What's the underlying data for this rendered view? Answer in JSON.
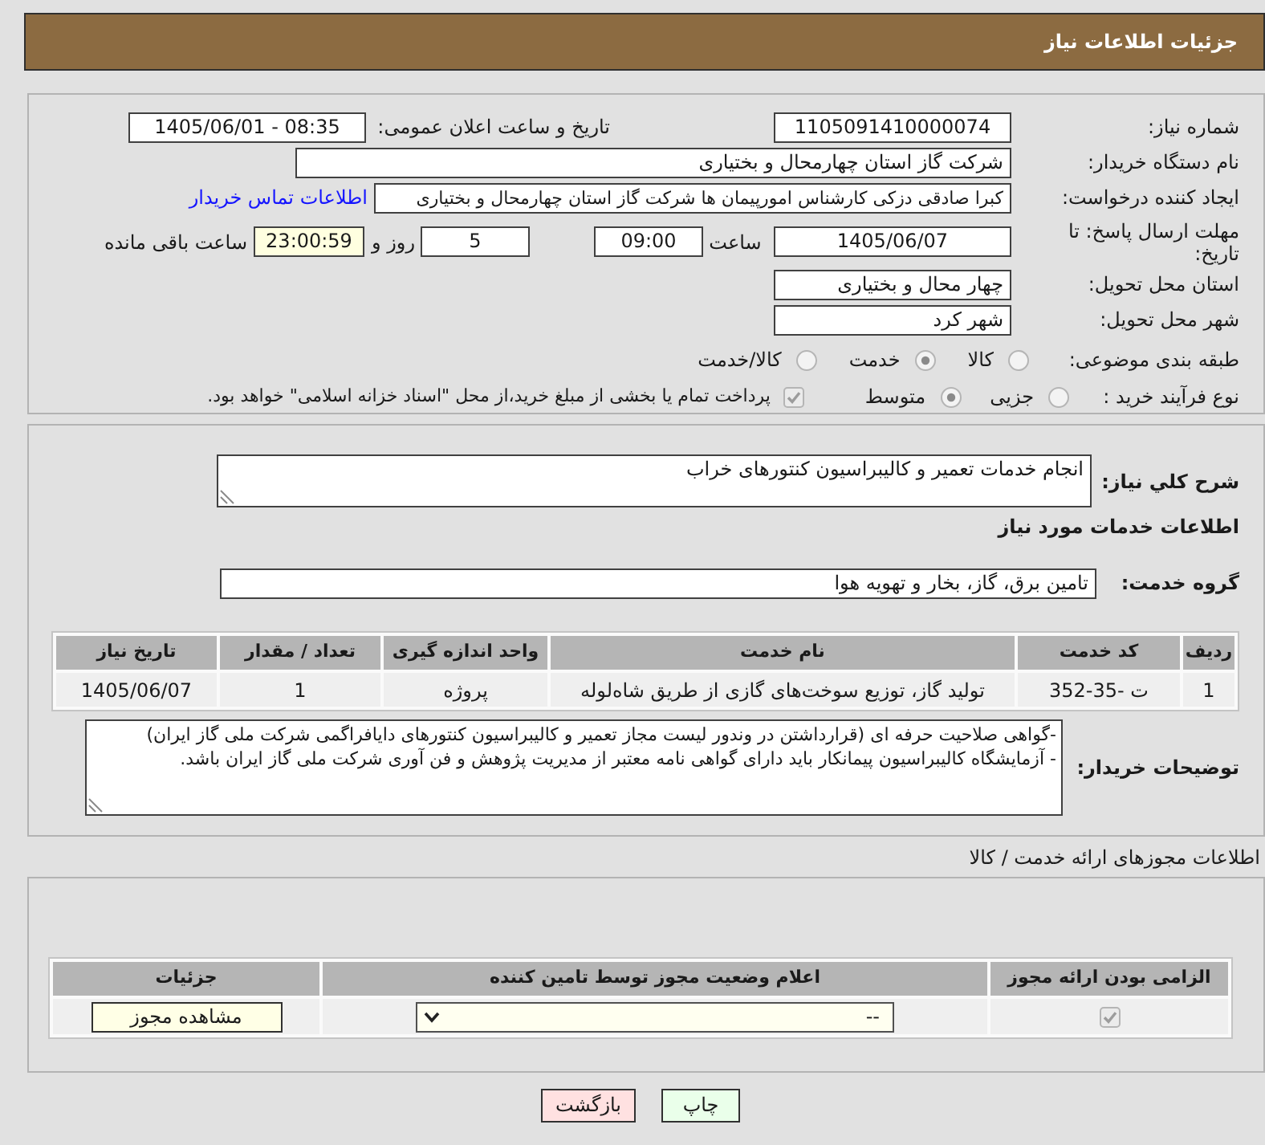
{
  "header": {
    "title": "جزئیات اطلاعات نیاز"
  },
  "details": {
    "need_number": {
      "label": "شماره نیاز:",
      "value": "1105091410000074"
    },
    "announce_datetime": {
      "label": "تاریخ و ساعت اعلان عمومی:",
      "value": "1405/06/01 - 08:35"
    },
    "buyer_org": {
      "label": "نام دستگاه خریدار:",
      "value": "شرکت گاز استان چهارمحال و بختیاری"
    },
    "requester": {
      "label": "ایجاد کننده درخواست:",
      "value": "کبرا صادقی دزکی کارشناس امورپیمان ها شرکت گاز استان چهارمحال و بختیاری",
      "link": "اطلاعات تماس خریدار"
    },
    "deadline": {
      "label": "مهلت ارسال پاسخ: تا تاریخ:",
      "date": "1405/06/07",
      "time_label": "ساعت",
      "time": "09:00",
      "days": "5",
      "days_label": "روز و",
      "remaining": "23:00:59",
      "remaining_label": "ساعت باقی مانده"
    },
    "province": {
      "label": "استان محل تحویل:",
      "value": "چهار محال و بختیاری"
    },
    "city": {
      "label": "شهر محل تحویل:",
      "value": "شهر کرد"
    },
    "category": {
      "label": "طبقه بندی موضوعی:",
      "options": [
        {
          "label": "کالا",
          "selected": false
        },
        {
          "label": "خدمت",
          "selected": true
        },
        {
          "label": "کالا/خدمت",
          "selected": false
        }
      ]
    },
    "process": {
      "label": "نوع فرآیند خرید :",
      "options": [
        {
          "label": "جزیی",
          "selected": false
        },
        {
          "label": "متوسط",
          "selected": true
        }
      ],
      "treasury": {
        "label": "پرداخت تمام یا بخشی از مبلغ خرید،از محل \"اسناد خزانه اسلامی\" خواهد بود.",
        "checked": true
      }
    }
  },
  "description": {
    "label": "شرح كلي نياز:",
    "value": "انجام خدمات تعمیر و کالیبراسیون کنتورهای خراب"
  },
  "services": {
    "title": "اطلاعات خدمات مورد نیاز",
    "group_label": "گروه خدمت:",
    "group_value": "تامین برق، گاز، بخار و تهویه هوا",
    "table": {
      "columns": [
        "ردیف",
        "کد خدمت",
        "نام خدمت",
        "واحد اندازه گیری",
        "تعداد / مقدار",
        "تاریخ نیاز"
      ],
      "rows": [
        [
          "1",
          "ت -35-352",
          "تولید گاز، توزیع سوخت‌های گازی از طریق شاه‌لوله",
          "پروژه",
          "1",
          "1405/06/07"
        ]
      ]
    },
    "notes_label": "توضیحات خریدار:",
    "notes": "-گواهی صلاحیت حرفه ای (قرارداشتن در وندور لیست مجاز تعمیر و کالیبراسیون کنتورهای دایافراگمی شرکت ملی گاز ایران)\n- آزمایشگاه کالیبراسیون پیمانکار باید دارای گواهی نامه معتبر از مدیریت پژوهش و فن آوری شرکت ملی گاز ایران باشد."
  },
  "permits": {
    "title": "اطلاعات مجوزهای ارائه خدمت / کالا",
    "columns": [
      "الزامی بودن ارائه مجوز",
      "اعلام وضعیت مجوز توسط تامین کننده",
      "جزئیات"
    ],
    "rows": [
      {
        "required": true,
        "status": "--",
        "action": "مشاهده مجوز"
      }
    ]
  },
  "buttons": [
    {
      "label": "چاپ",
      "kind": "print"
    },
    {
      "label": "بازگشت",
      "kind": "back"
    }
  ]
}
